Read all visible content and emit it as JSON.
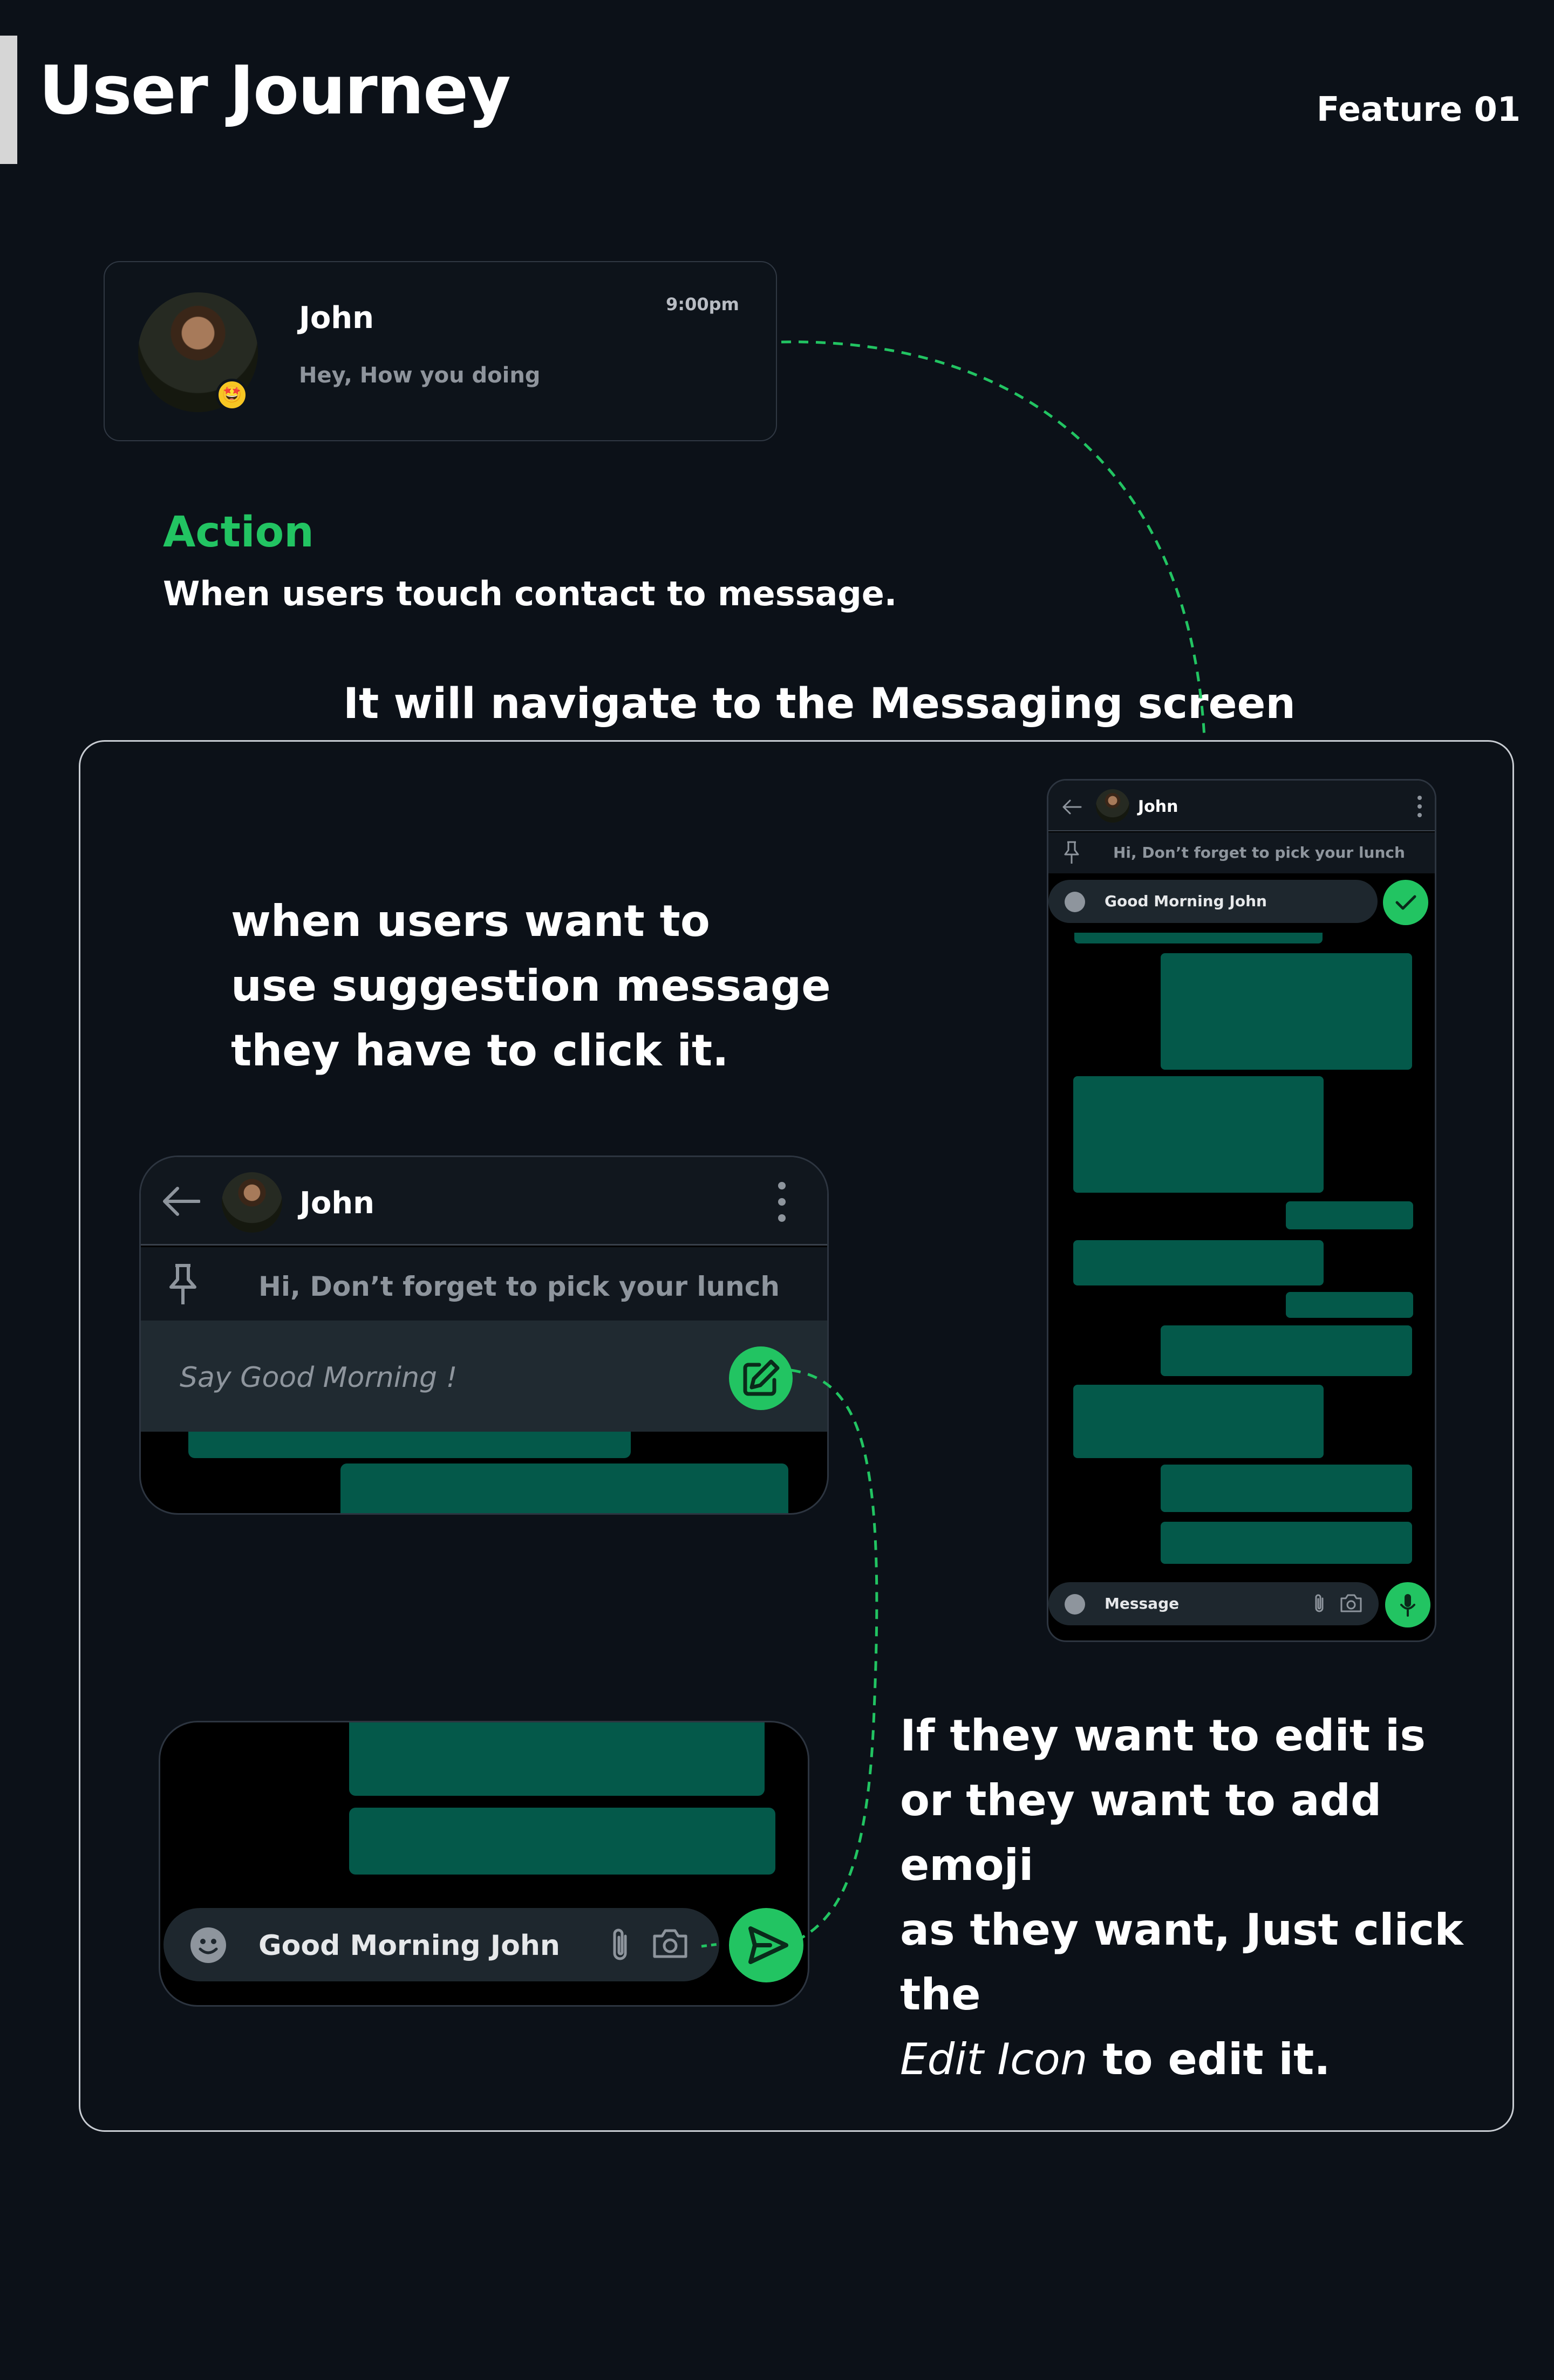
{
  "header": {
    "title": "User Journey",
    "feature": "Feature 01"
  },
  "contact_card": {
    "name": "John",
    "time": "9:00pm",
    "preview": "Hey, How you doing",
    "badge_emoji": "🤩"
  },
  "action": {
    "title": "Action",
    "description": "When users touch contact to message."
  },
  "navigate_text": "It will navigate to the Messaging screen",
  "suggestion_explainer": {
    "lines": [
      "when users want to",
      "use suggestion message",
      "they have to click it."
    ]
  },
  "edit_explainer": {
    "line1": "If they want to edit is",
    "line2": "or they want to add emoji",
    "line3": "as they want, Just click the",
    "line4_em": "Edit Icon",
    "line4_rest": " to edit it."
  },
  "chat_panel": {
    "contact_name": "John",
    "pinned_message": "Hi, Don’t forget to pick your lunch",
    "suggestion": "Say Good Morning !"
  },
  "compose_panel": {
    "input_value": "Good Morning John"
  },
  "phone": {
    "contact_name": "John",
    "pinned_message": "Hi, Don’t forget to pick your lunch",
    "suggest_input_value": "Good Morning John",
    "message_placeholder": "Message"
  },
  "colors": {
    "background": "#0c1118",
    "accent_green": "#22c462",
    "bubble_green": "#04594a",
    "panel_dark": "#11171e",
    "input_dark": "#1e272e"
  },
  "icons": [
    "back-arrow-icon",
    "more-vertical-icon",
    "pin-icon",
    "edit-icon",
    "emoji-icon",
    "attach-icon",
    "camera-icon",
    "send-icon",
    "check-icon",
    "mic-icon"
  ]
}
